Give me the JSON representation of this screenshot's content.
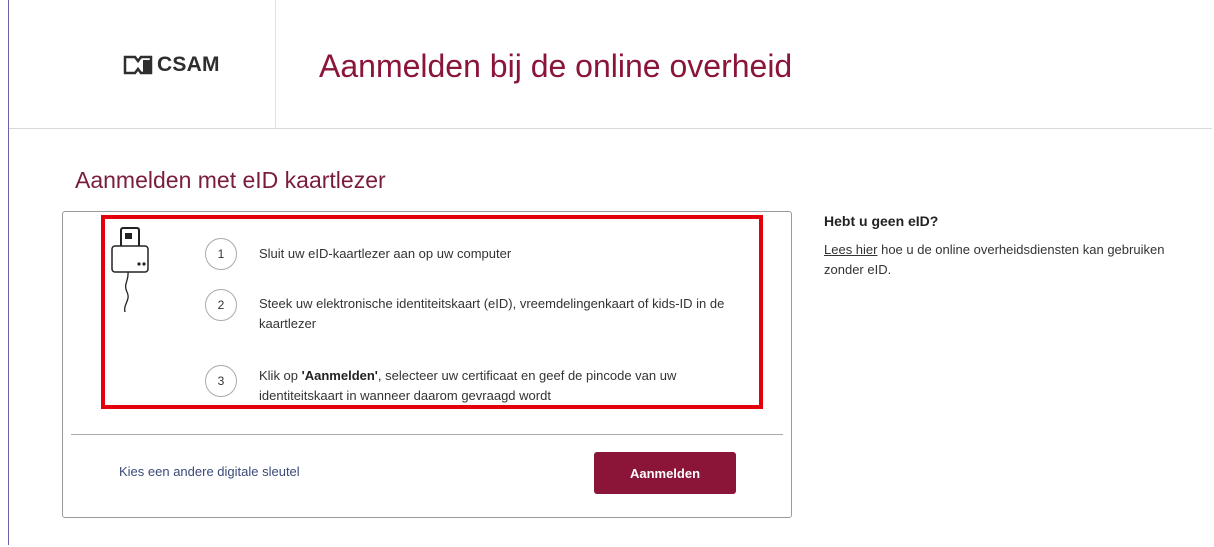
{
  "header": {
    "logo_text": "CSAM",
    "title": "Aanmelden bij de online overheid"
  },
  "main": {
    "section_title": "Aanmelden met eID kaartlezer",
    "steps": [
      {
        "number": "1",
        "text": "Sluit uw eID-kaartlezer aan op uw computer"
      },
      {
        "number": "2",
        "text": "Steek uw elektronische identiteitskaart (eID), vreemdelingenkaart of kids-ID in de kaartlezer"
      },
      {
        "number": "3",
        "text_bold": "'Aanmelden'",
        "text_pre": "Klik op ",
        "text_post": ", selecteer uw certificaat en geef de pincode van uw identiteitskaart in wanneer daarom gevraagd wordt"
      }
    ],
    "alt_link": "Kies een andere digitale sleutel",
    "login_button": "Aanmelden"
  },
  "sidebar": {
    "title": "Hebt u geen eID?",
    "link_text": "Lees hier",
    "text": " hoe u de online overheidsdiensten kan gebruiken zonder eID."
  },
  "colors": {
    "brand": "#8a1538",
    "highlight": "#e3000b"
  },
  "icons": [
    "csam-logo-icon",
    "card-reader-icon"
  ]
}
